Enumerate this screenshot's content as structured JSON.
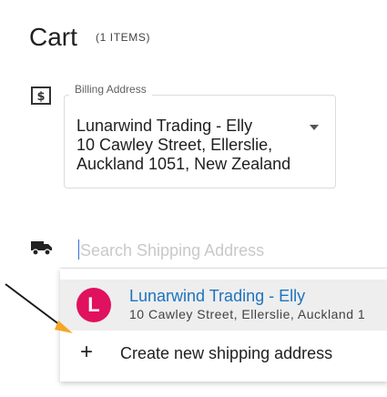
{
  "header": {
    "title": "Cart",
    "item_count": "(1 ITEMS)"
  },
  "billing": {
    "legend": "Billing Address",
    "icon": "billing-receipt-icon",
    "lines": [
      "Lunarwind Trading - Elly",
      "10 Cawley Street, Ellerslie,",
      "Auckland 1051, New Zealand"
    ]
  },
  "shipping": {
    "icon": "truck-icon",
    "search_placeholder": "Search Shipping Address",
    "search_value": "",
    "options": [
      {
        "avatar_letter": "L",
        "name": "Lunarwind Trading - Elly",
        "address": "10 Cawley Street, Ellerslie, Auckland 1"
      }
    ],
    "create_label": "Create new shipping address"
  },
  "colors": {
    "accent": "#1e73be",
    "avatar": "#e0115f",
    "annotation_arrow": "#f5a623"
  }
}
